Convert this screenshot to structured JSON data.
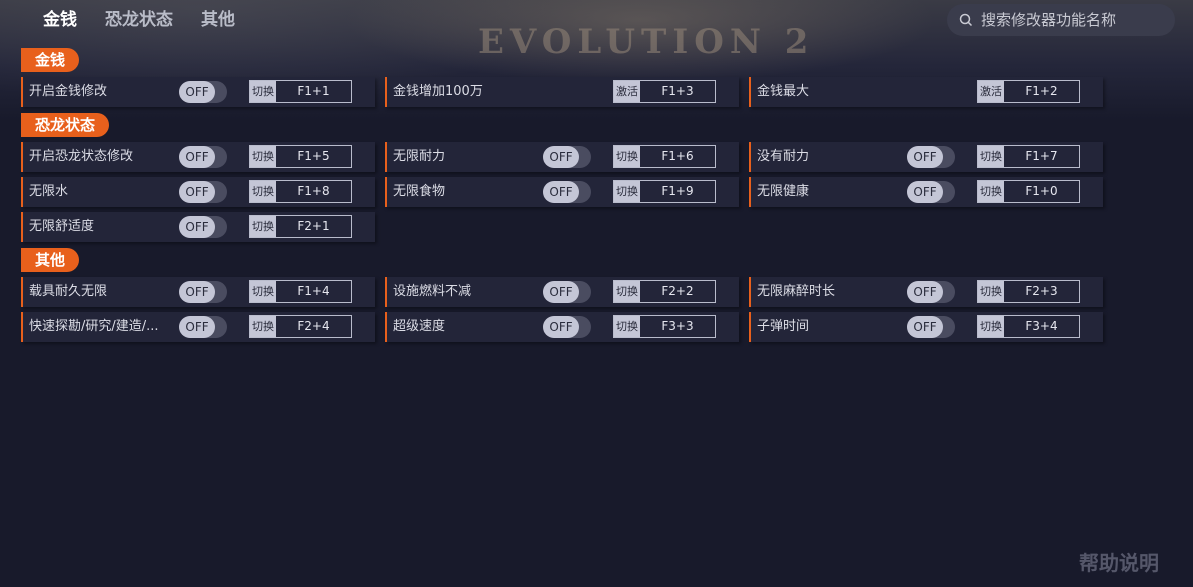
{
  "tabs": [
    {
      "label": "金钱",
      "active": true
    },
    {
      "label": "恐龙状态",
      "active": false
    },
    {
      "label": "其他",
      "active": false
    }
  ],
  "search": {
    "placeholder": "搜索修改器功能名称"
  },
  "sections": {
    "money": {
      "title": "金钱"
    },
    "dino": {
      "title": "恐龙状态"
    },
    "other": {
      "title": "其他"
    }
  },
  "toggle_label": "OFF",
  "rows": [
    {
      "label": "开启金钱修改",
      "has_toggle": true,
      "action": "切换",
      "key": "F1+1"
    },
    {
      "label": "金钱增加100万",
      "has_toggle": false,
      "action": "激活",
      "key": "F1+3"
    },
    {
      "label": "金钱最大",
      "has_toggle": false,
      "action": "激活",
      "key": "F1+2"
    },
    {
      "label": "开启恐龙状态修改",
      "has_toggle": true,
      "action": "切换",
      "key": "F1+5"
    },
    {
      "label": "无限耐力",
      "has_toggle": true,
      "action": "切换",
      "key": "F1+6"
    },
    {
      "label": "没有耐力",
      "has_toggle": true,
      "action": "切换",
      "key": "F1+7"
    },
    {
      "label": "无限水",
      "has_toggle": true,
      "action": "切换",
      "key": "F1+8"
    },
    {
      "label": "无限食物",
      "has_toggle": true,
      "action": "切换",
      "key": "F1+9"
    },
    {
      "label": "无限健康",
      "has_toggle": true,
      "action": "切换",
      "key": "F1+0"
    },
    {
      "label": "无限舒适度",
      "has_toggle": true,
      "action": "切换",
      "key": "F2+1"
    },
    {
      "label": "载具耐久无限",
      "has_toggle": true,
      "action": "切换",
      "key": "F1+4"
    },
    {
      "label": "设施燃料不减",
      "has_toggle": true,
      "action": "切换",
      "key": "F2+2"
    },
    {
      "label": "无限麻醉时长",
      "has_toggle": true,
      "action": "切换",
      "key": "F2+3"
    },
    {
      "label": "快速探勘/研究/建造/...",
      "has_toggle": true,
      "action": "切换",
      "key": "F2+4"
    },
    {
      "label": "超级速度",
      "has_toggle": true,
      "action": "切换",
      "key": "F3+3"
    },
    {
      "label": "子弹时间",
      "has_toggle": true,
      "action": "切换",
      "key": "F3+4"
    }
  ],
  "help_label": "帮助说明",
  "colors": {
    "accent": "#e8601c",
    "background": "#181a2b",
    "row_bg": "#232539"
  }
}
